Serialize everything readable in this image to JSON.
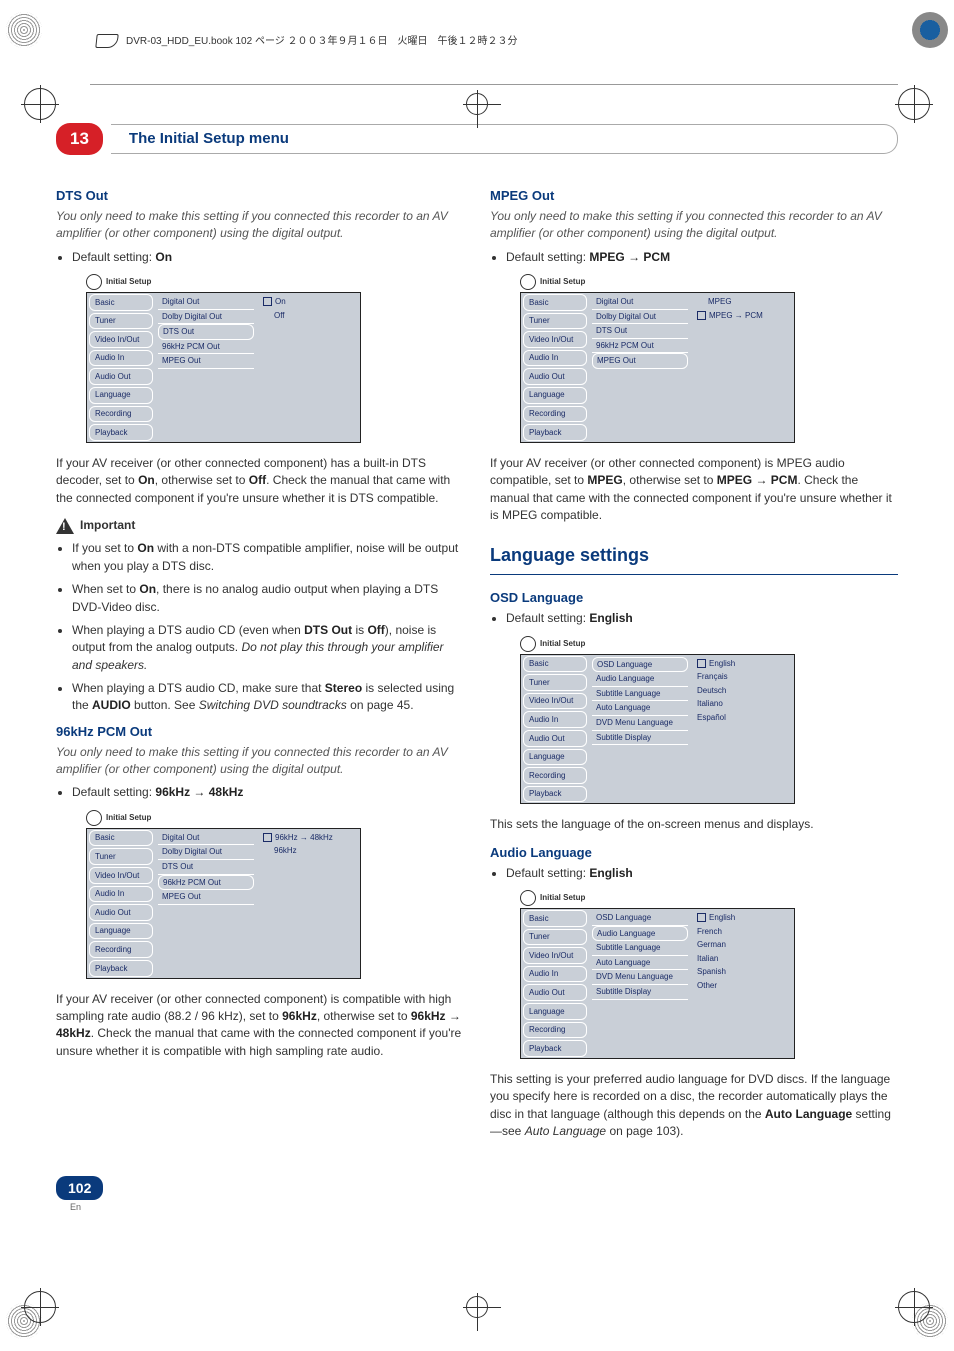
{
  "book_header": "DVR-03_HDD_EU.book 102 ページ ２００３年９月１６日　火曜日　午後１２時２３分",
  "chapter": {
    "num": "13",
    "title": "The Initial Setup menu"
  },
  "dts": {
    "heading": "DTS Out",
    "intro": "You only need to make this setting if you connected this recorder to an AV amplifier (or other component) using the digital output.",
    "default_label": "Default setting: ",
    "default_value": "On",
    "osd_title": "Initial Setup",
    "side": [
      "Basic",
      "Tuner",
      "Video In/Out",
      "Audio In",
      "Audio Out",
      "Language",
      "Recording",
      "Playback"
    ],
    "mid": [
      "Digital Out",
      "Dolby Digital Out",
      "DTS Out",
      "96kHz PCM Out",
      "MPEG Out"
    ],
    "right": [
      "On",
      "Off"
    ],
    "para1_a": "If your AV receiver (or other connected component) has a built-in DTS decoder, set to ",
    "para1_on": "On",
    "para1_b": ", otherwise set to ",
    "para1_off": "Off",
    "para1_c": ". Check the manual that came with the connected component if you're unsure whether it is DTS compatible.",
    "important": "Important",
    "bul1_a": "If you set to ",
    "bul1_on": "On",
    "bul1_b": " with a non-DTS compatible amplifier, noise will be output when you play a DTS disc.",
    "bul2_a": "When set to ",
    "bul2_on": "On",
    "bul2_b": ", there is no analog audio output when playing a DTS DVD-Video disc.",
    "bul3_a": "When playing a DTS audio CD (even when ",
    "bul3_bold": "DTS Out",
    "bul3_b": " is ",
    "bul3_off": "Off",
    "bul3_c": "), noise is output from the analog outputs. ",
    "bul3_italic": "Do not play this through your amplifier and speakers.",
    "bul4_a": "When playing a DTS audio CD, make sure that ",
    "bul4_stereo": "Stereo",
    "bul4_b": " is selected using the ",
    "bul4_audio": "AUDIO",
    "bul4_c": " button. See ",
    "bul4_italic": "Switching DVD soundtracks",
    "bul4_d": " on page 45."
  },
  "pcm": {
    "heading": "96kHz PCM Out",
    "intro": "You only need to make this setting if you connected this recorder to an AV amplifier (or other component) using the digital output.",
    "default_label": "Default setting: ",
    "default_value": "96kHz → 48kHz",
    "osd_title": "Initial Setup",
    "side": [
      "Basic",
      "Tuner",
      "Video In/Out",
      "Audio In",
      "Audio Out",
      "Language",
      "Recording",
      "Playback"
    ],
    "mid": [
      "Digital Out",
      "Dolby Digital Out",
      "DTS Out",
      "96kHz PCM Out",
      "MPEG Out"
    ],
    "right": [
      "96kHz → 48kHz",
      "96kHz"
    ],
    "para_a": "If your AV receiver (or other connected component) is compatible with high sampling rate audio (88.2 / 96 kHz), set to ",
    "para_b1": "96kHz",
    "para_b": ", otherwise set to ",
    "para_b2": "96kHz → 48kHz",
    "para_c": ". Check the manual that came with the connected component if you're unsure whether it is compatible with high sampling rate audio."
  },
  "mpeg": {
    "heading": "MPEG Out",
    "intro": "You only need to make this setting if you connected this recorder to an AV amplifier (or other component) using the digital output.",
    "default_label": "Default setting: ",
    "default_value": "MPEG → PCM",
    "osd_title": "Initial Setup",
    "side": [
      "Basic",
      "Tuner",
      "Video In/Out",
      "Audio In",
      "Audio Out",
      "Language",
      "Recording",
      "Playback"
    ],
    "mid": [
      "Digital Out",
      "Dolby Digital Out",
      "DTS Out",
      "96kHz PCM Out",
      "MPEG Out"
    ],
    "right": [
      "MPEG",
      "MPEG → PCM"
    ],
    "para_a": "If your AV receiver (or other connected component) is MPEG audio compatible, set to ",
    "para_b1": "MPEG",
    "para_b": ", otherwise set to ",
    "para_b2": "MPEG → PCM",
    "para_c": ". Check the manual that came with the connected component if you're unsure whether it is MPEG compatible."
  },
  "lang_section": "Language settings",
  "osd_lang": {
    "heading": "OSD Language",
    "default_label": "Default setting: ",
    "default_value": "English",
    "osd_title": "Initial Setup",
    "side": [
      "Basic",
      "Tuner",
      "Video In/Out",
      "Audio In",
      "Audio Out",
      "Language",
      "Recording",
      "Playback"
    ],
    "mid": [
      "OSD Language",
      "Audio Language",
      "Subtitle Language",
      "Auto Language",
      "DVD Menu Language",
      "Subtitle Display"
    ],
    "right": [
      "English",
      "Français",
      "Deutsch",
      "Italiano",
      "Español"
    ],
    "para": "This sets the language of the on-screen menus and displays."
  },
  "audio_lang": {
    "heading": "Audio Language",
    "default_label": "Default setting: ",
    "default_value": "English",
    "osd_title": "Initial Setup",
    "side": [
      "Basic",
      "Tuner",
      "Video In/Out",
      "Audio In",
      "Audio Out",
      "Language",
      "Recording",
      "Playback"
    ],
    "mid": [
      "OSD Language",
      "Audio Language",
      "Subtitle Language",
      "Auto Language",
      "DVD Menu Language",
      "Subtitle Display"
    ],
    "right": [
      "English",
      "French",
      "German",
      "Italian",
      "Spanish",
      "Other"
    ],
    "para_a": "This setting is your preferred audio language for DVD discs. If the language you specify here is recorded on a disc, the recorder automatically plays the disc in that language (although this depends on the ",
    "para_bold": "Auto Language",
    "para_b": " setting—see ",
    "para_italic": "Auto Language",
    "para_c": " on page 103)."
  },
  "page": {
    "num": "102",
    "lang": "En"
  }
}
